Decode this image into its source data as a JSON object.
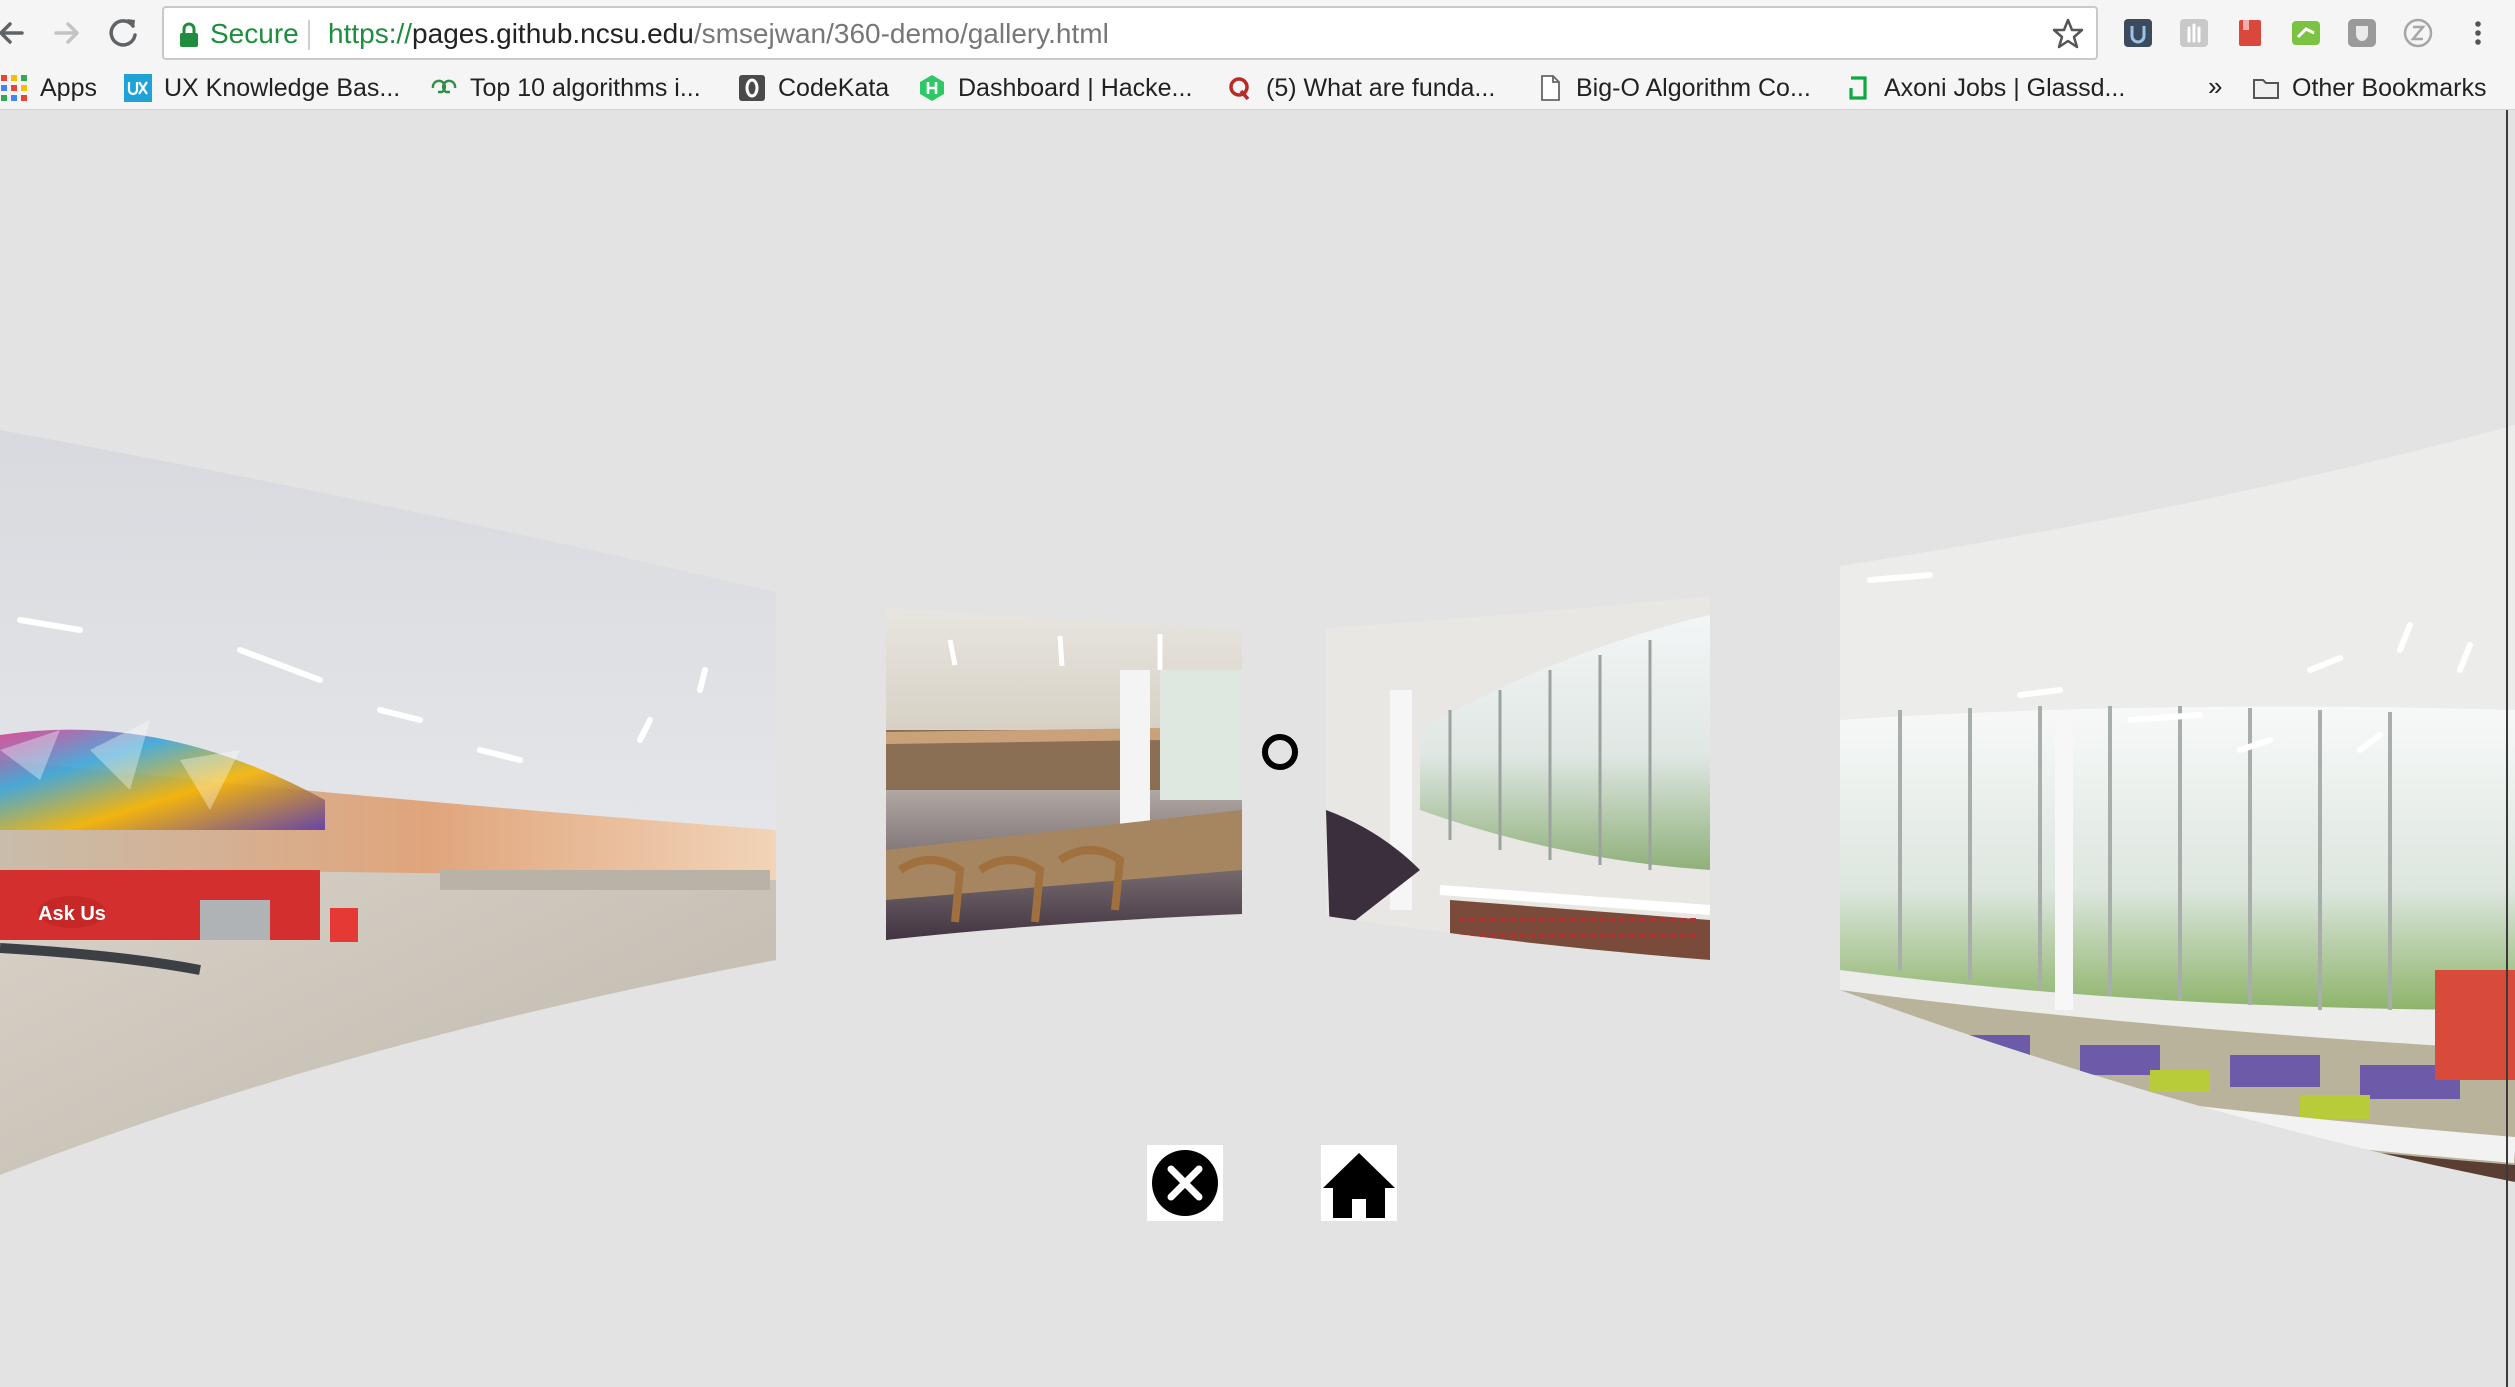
{
  "browser": {
    "secure_label": "Secure",
    "url": {
      "scheme": "https://",
      "host": "pages.github.ncsu.edu",
      "path": "/smsejwan/360-demo/gallery.html"
    },
    "colors": {
      "secure_green": "#1e8e3e",
      "chrome_bg": "#f5f5f5"
    }
  },
  "bookmarks": {
    "items": [
      {
        "label": "Apps",
        "icon": "apps-grid-icon"
      },
      {
        "label": "UX Knowledge Bas...",
        "icon": "ux-favicon"
      },
      {
        "label": "Top 10 algorithms i...",
        "icon": "geeksforgeeks-favicon"
      },
      {
        "label": "CodeKata",
        "icon": "codekata-favicon"
      },
      {
        "label": "Dashboard | Hacke...",
        "icon": "hackerrank-favicon"
      },
      {
        "label": "(5) What are funda...",
        "icon": "quora-favicon"
      },
      {
        "label": "Big-O Algorithm Co...",
        "icon": "page-icon"
      },
      {
        "label": "Axoni Jobs | Glassd...",
        "icon": "glassdoor-favicon"
      }
    ],
    "more_label": "»",
    "other_label": "Other Bookmarks"
  },
  "scene": {
    "background": "#e3e3e3",
    "panels": [
      {
        "name": "atrium-panorama",
        "subject": "library atrium with colorful mural and Ask Us desk"
      },
      {
        "name": "reading-room-panorama",
        "subject": "reading room with wooden tables and chairs"
      },
      {
        "name": "stacks-window-panorama",
        "subject": "bookshelves along curved glass windows"
      },
      {
        "name": "lounge-panorama",
        "subject": "lounge with colorful seating and large windows"
      }
    ],
    "sign_text": "Ask Us",
    "controls": {
      "cursor": "gaze-cursor-ring",
      "close_icon": "close-circle-icon",
      "home_icon": "home-icon"
    }
  }
}
